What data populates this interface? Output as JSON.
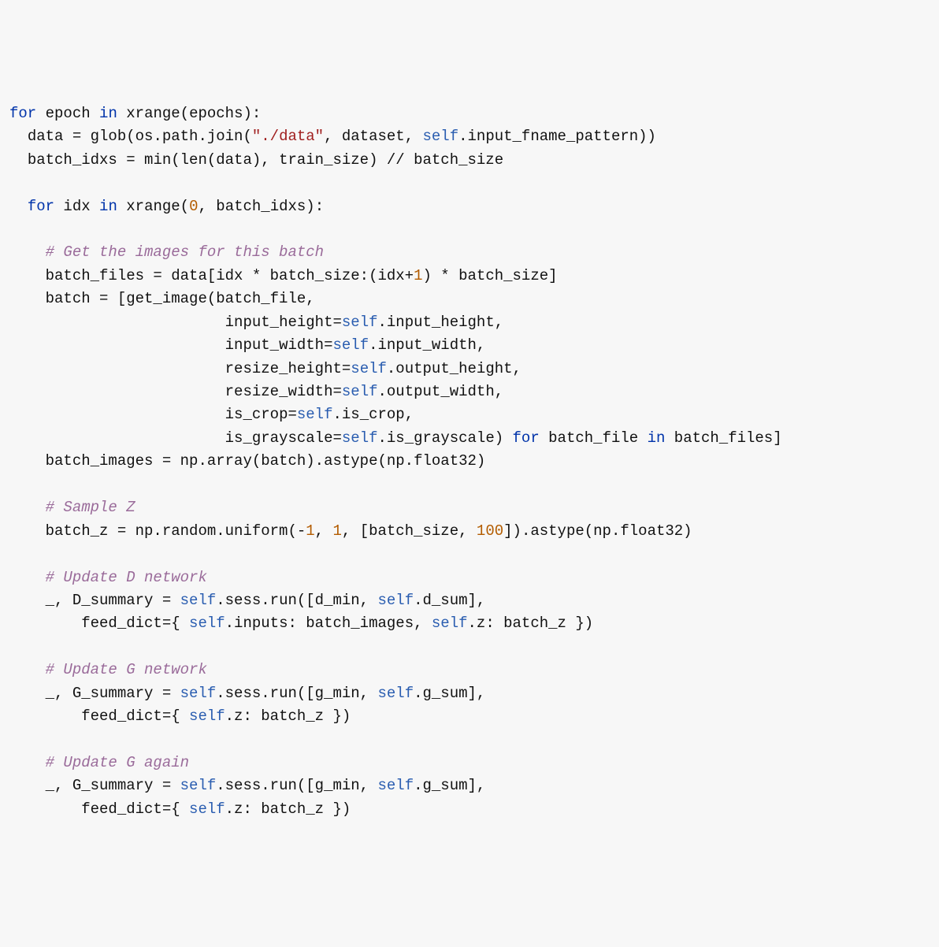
{
  "colors": {
    "background": "#f7f7f7",
    "default": "#111111",
    "keyword": "#0033aa",
    "number": "#b35c00",
    "string": "#a01f1f",
    "self": "#2a5db0",
    "comment": "#9a6b9a"
  },
  "indent_unit": "  ",
  "code": [
    {
      "indent": 0,
      "tokens": [
        {
          "t": "for",
          "k": "kw"
        },
        {
          "t": " epoch "
        },
        {
          "t": "in",
          "k": "kw"
        },
        {
          "t": " xrange(epochs):"
        }
      ]
    },
    {
      "indent": 1,
      "tokens": [
        {
          "t": "data = glob(os.path.join("
        },
        {
          "t": "\"./data\"",
          "k": "str"
        },
        {
          "t": ", dataset, "
        },
        {
          "t": "self",
          "k": "slf"
        },
        {
          "t": ".input_fname_pattern))"
        }
      ]
    },
    {
      "indent": 1,
      "tokens": [
        {
          "t": "batch_idxs = min(len(data), train_size) // batch_size"
        }
      ]
    },
    {
      "indent": 0,
      "tokens": []
    },
    {
      "indent": 1,
      "tokens": [
        {
          "t": "for",
          "k": "kw"
        },
        {
          "t": " idx "
        },
        {
          "t": "in",
          "k": "kw"
        },
        {
          "t": " xrange("
        },
        {
          "t": "0",
          "k": "num"
        },
        {
          "t": ", batch_idxs):"
        }
      ]
    },
    {
      "indent": 0,
      "tokens": []
    },
    {
      "indent": 2,
      "tokens": [
        {
          "t": "# Get the images for this batch",
          "k": "com"
        }
      ]
    },
    {
      "indent": 2,
      "tokens": [
        {
          "t": "batch_files = data[idx * batch_size:(idx+"
        },
        {
          "t": "1",
          "k": "num"
        },
        {
          "t": ") * batch_size]"
        }
      ]
    },
    {
      "indent": 2,
      "tokens": [
        {
          "t": "batch = [get_image(batch_file,"
        }
      ]
    },
    {
      "indent": 12,
      "tokens": [
        {
          "t": "input_height="
        },
        {
          "t": "self",
          "k": "slf"
        },
        {
          "t": ".input_height,"
        }
      ]
    },
    {
      "indent": 12,
      "tokens": [
        {
          "t": "input_width="
        },
        {
          "t": "self",
          "k": "slf"
        },
        {
          "t": ".input_width,"
        }
      ]
    },
    {
      "indent": 12,
      "tokens": [
        {
          "t": "resize_height="
        },
        {
          "t": "self",
          "k": "slf"
        },
        {
          "t": ".output_height,"
        }
      ]
    },
    {
      "indent": 12,
      "tokens": [
        {
          "t": "resize_width="
        },
        {
          "t": "self",
          "k": "slf"
        },
        {
          "t": ".output_width,"
        }
      ]
    },
    {
      "indent": 12,
      "tokens": [
        {
          "t": "is_crop="
        },
        {
          "t": "self",
          "k": "slf"
        },
        {
          "t": ".is_crop,"
        }
      ]
    },
    {
      "indent": 12,
      "tokens": [
        {
          "t": "is_grayscale="
        },
        {
          "t": "self",
          "k": "slf"
        },
        {
          "t": ".is_grayscale) "
        },
        {
          "t": "for",
          "k": "kw"
        },
        {
          "t": " batch_file "
        },
        {
          "t": "in",
          "k": "kw"
        },
        {
          "t": " batch_files]"
        }
      ]
    },
    {
      "indent": 2,
      "tokens": [
        {
          "t": "batch_images = np.array(batch).astype(np.float32)"
        }
      ]
    },
    {
      "indent": 0,
      "tokens": []
    },
    {
      "indent": 2,
      "tokens": [
        {
          "t": "# Sample Z",
          "k": "com"
        }
      ]
    },
    {
      "indent": 2,
      "tokens": [
        {
          "t": "batch_z = np.random.uniform(-"
        },
        {
          "t": "1",
          "k": "num"
        },
        {
          "t": ", "
        },
        {
          "t": "1",
          "k": "num"
        },
        {
          "t": ", [batch_size, "
        },
        {
          "t": "100",
          "k": "num"
        },
        {
          "t": "]).astype(np.float32)"
        }
      ]
    },
    {
      "indent": 0,
      "tokens": []
    },
    {
      "indent": 2,
      "tokens": [
        {
          "t": "# Update D network",
          "k": "com"
        }
      ]
    },
    {
      "indent": 2,
      "tokens": [
        {
          "t": "_, D_summary = "
        },
        {
          "t": "self",
          "k": "slf"
        },
        {
          "t": ".sess.run([d_min, "
        },
        {
          "t": "self",
          "k": "slf"
        },
        {
          "t": ".d_sum],"
        }
      ]
    },
    {
      "indent": 4,
      "tokens": [
        {
          "t": "feed_dict={ "
        },
        {
          "t": "self",
          "k": "slf"
        },
        {
          "t": ".inputs: batch_images, "
        },
        {
          "t": "self",
          "k": "slf"
        },
        {
          "t": ".z: batch_z })"
        }
      ]
    },
    {
      "indent": 0,
      "tokens": []
    },
    {
      "indent": 2,
      "tokens": [
        {
          "t": "# Update G network",
          "k": "com"
        }
      ]
    },
    {
      "indent": 2,
      "tokens": [
        {
          "t": "_, G_summary = "
        },
        {
          "t": "self",
          "k": "slf"
        },
        {
          "t": ".sess.run([g_min, "
        },
        {
          "t": "self",
          "k": "slf"
        },
        {
          "t": ".g_sum],"
        }
      ]
    },
    {
      "indent": 4,
      "tokens": [
        {
          "t": "feed_dict={ "
        },
        {
          "t": "self",
          "k": "slf"
        },
        {
          "t": ".z: batch_z })"
        }
      ]
    },
    {
      "indent": 0,
      "tokens": []
    },
    {
      "indent": 2,
      "tokens": [
        {
          "t": "# Update G again",
          "k": "com"
        }
      ]
    },
    {
      "indent": 2,
      "tokens": [
        {
          "t": "_, G_summary = "
        },
        {
          "t": "self",
          "k": "slf"
        },
        {
          "t": ".sess.run([g_min, "
        },
        {
          "t": "self",
          "k": "slf"
        },
        {
          "t": ".g_sum],"
        }
      ]
    },
    {
      "indent": 4,
      "tokens": [
        {
          "t": "feed_dict={ "
        },
        {
          "t": "self",
          "k": "slf"
        },
        {
          "t": ".z: batch_z })"
        }
      ]
    }
  ]
}
